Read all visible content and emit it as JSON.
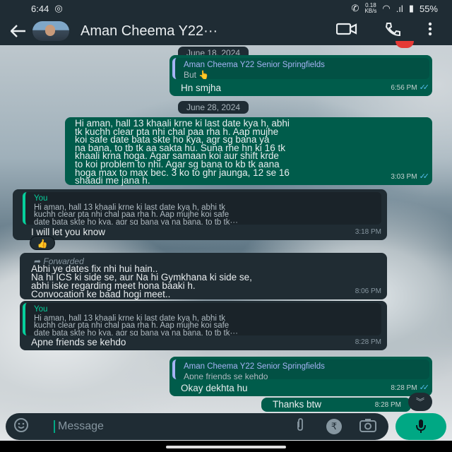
{
  "status_bar": {
    "time": "6:44",
    "net_speed": "0.18",
    "net_unit": "KB/s",
    "battery": "55%"
  },
  "header": {
    "contact_name": "Aman Cheema Y22···"
  },
  "messages": [
    {
      "quote_author": "Aman Cheema Y22 Senior Springfields",
      "quote_text": "But 👆",
      "text": "Hn smjha",
      "time": "6:56 PM"
    },
    {
      "text_lines": [
        "Hi aman, hall 13 khaali krne ki last date kya h, abhi",
        "tk kuchh clear pta nhi chal paa rha h. Aap mujhe",
        "koi safe date bata skte ho kya, agr sg bana ya",
        "na bana, to tb tk aa sakta hu. Suna rhe hn ki 16 tk",
        "khaali krna hoga. Agar samaan koi aur shift krde",
        "to koi problem to nhi. Agar sg bana to kb tk aana",
        "hoga max to max bec. 3 ko to ghr jaunga, 12 se 16",
        "shaadi me jana h."
      ],
      "time": "3:03 PM"
    },
    {
      "quote_author": "You",
      "quote_lines": [
        "Hi aman, hall 13 khaali krne ki last date kya h, abhi tk",
        "kuchh clear pta nhi chal paa rha h. Aap mujhe koi safe",
        "date bata skte ho kya, agr sg bana ya na bana, to tb tk···"
      ],
      "text": "I will let you know",
      "time": "3:18 PM",
      "reaction": "👍"
    },
    {
      "forwarded_label": "Forwarded",
      "text_lines": [
        "Abhi ye dates fix nhi hui hain..",
        "Na hi ICS ki side se, aur Na hi Gymkhana ki side se,",
        "abhi iske regarding meet hona baaki h.",
        "Convocation ke baad hogi meet.."
      ],
      "time": "8:06 PM"
    },
    {
      "quote_author": "You",
      "quote_lines": [
        "Hi aman, hall 13 khaali krne ki last date kya h, abhi tk",
        "kuchh clear pta nhi chal paa rha h. Aap mujhe koi safe",
        "date bata skte ho kya, agr sg bana ya na bana, to tb tk···"
      ],
      "text": "Apne friends se kehdo",
      "time": "8:28 PM"
    },
    {
      "quote_author": "Aman Cheema Y22 Senior Springfields",
      "quote_text": "Apne friends se kehdo",
      "text": "Okay dekhta hu",
      "time": "8:28 PM"
    },
    {
      "text": "Thanks btw",
      "time": "8:28 PM"
    }
  ],
  "date_chips": [
    "June 18, 2024",
    "June 28, 2024"
  ],
  "input": {
    "placeholder": "Message"
  },
  "icons": {
    "back": "back-arrow-icon",
    "video": "video-call-icon",
    "call": "phone-call-icon",
    "menu": "more-options-icon",
    "emoji": "emoji-icon",
    "attach": "attach-icon",
    "payment": "rupee-icon",
    "camera": "camera-icon",
    "mic": "mic-icon"
  },
  "colors": {
    "outgoing_bubble": "#005c4b",
    "incoming_bubble": "#202c33",
    "header": "#1f2c34",
    "accent": "#00a884",
    "read_ticks": "#53bdeb"
  }
}
